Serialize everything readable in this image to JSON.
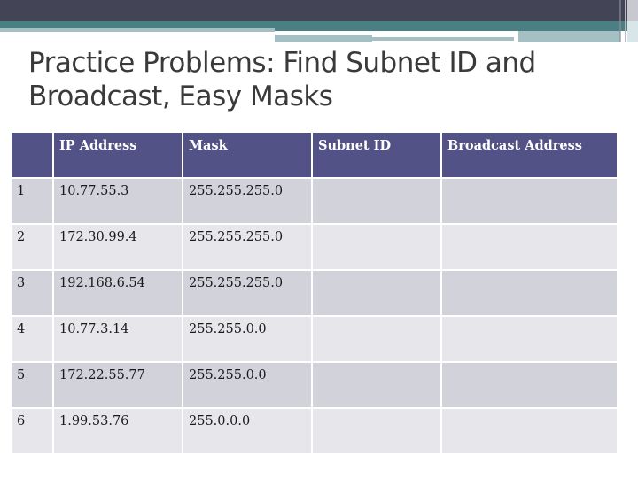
{
  "slide": {
    "title": "Practice Problems: Find Subnet ID and Broadcast, Easy Masks",
    "theme_colors": {
      "top_bar": "#434556",
      "accent_teal": "#4a7f84",
      "light_teal": "#a5bfc2",
      "table_header": "#525287",
      "row_dark": "#d1d2da",
      "row_light": "#e7e7eb"
    }
  },
  "table": {
    "headers": [
      "",
      "IP Address",
      "Mask",
      "Subnet ID",
      "Broadcast Address"
    ],
    "rows": [
      {
        "num": "1",
        "ip": "10.77.55.3",
        "mask": "255.255.255.0",
        "subnet_id": "",
        "broadcast": ""
      },
      {
        "num": "2",
        "ip": "172.30.99.4",
        "mask": "255.255.255.0",
        "subnet_id": "",
        "broadcast": ""
      },
      {
        "num": "3",
        "ip": "192.168.6.54",
        "mask": "255.255.255.0",
        "subnet_id": "",
        "broadcast": ""
      },
      {
        "num": "4",
        "ip": "10.77.3.14",
        "mask": "255.255.0.0",
        "subnet_id": "",
        "broadcast": ""
      },
      {
        "num": "5",
        "ip": "172.22.55.77",
        "mask": "255.255.0.0",
        "subnet_id": "",
        "broadcast": ""
      },
      {
        "num": "6",
        "ip": "1.99.53.76",
        "mask": "255.0.0.0",
        "subnet_id": "",
        "broadcast": ""
      }
    ]
  }
}
